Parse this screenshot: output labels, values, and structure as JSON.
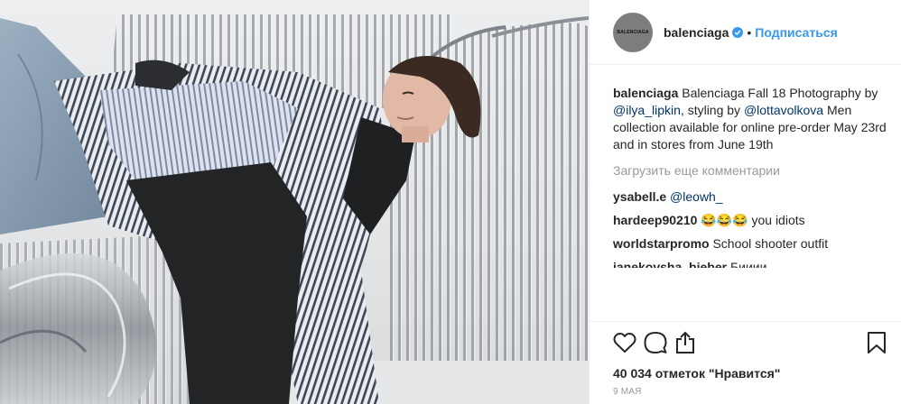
{
  "header": {
    "username": "balenciaga",
    "avatar_text": "BALENCIAGA",
    "separator": "•",
    "follow_label": "Подписаться"
  },
  "caption": {
    "username": "balenciaga",
    "text_1": "Balenciaga Fall 18 Photography by",
    "mention_1": "@ilya_lipkin",
    "text_2": ", styling by",
    "mention_2": "@lottavolkova",
    "text_3": "Men collection available for online pre-order May 23rd and in stores from June 19th"
  },
  "load_more_label": "Загрузить еще комментарии",
  "comments": [
    {
      "username": "ysabell.e",
      "mention": "@leowh_",
      "text": ""
    },
    {
      "username": "hardeep90210",
      "emoji": "😂😂😂",
      "text": "you idiots"
    },
    {
      "username": "worldstarpromo",
      "text": "School shooter outfit"
    },
    {
      "username": "janekovsha_bieber",
      "text": "Бииии"
    }
  ],
  "actions": {
    "like_icon": "heart-icon",
    "comment_icon": "comment-icon",
    "share_icon": "share-icon",
    "save_icon": "bookmark-icon"
  },
  "likes_text": "40 034 отметок \"Нравится\"",
  "date_text": "9 мая",
  "colors": {
    "accent": "#3897f0",
    "link": "#003569",
    "muted": "#999999",
    "text": "#262626"
  }
}
